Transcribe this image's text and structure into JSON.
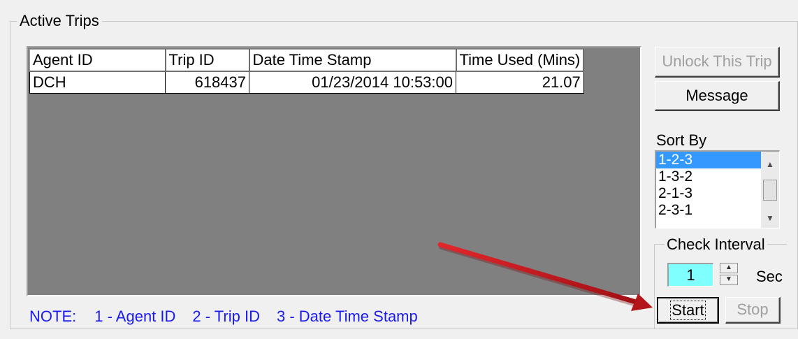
{
  "group_title": "Active Trips",
  "grid": {
    "columns": [
      "Agent ID",
      "Trip ID",
      "Date Time Stamp",
      "Time Used (Mins)"
    ],
    "rows": [
      [
        "DCH",
        "618437",
        "01/23/2014 10:53:00",
        "21.07"
      ]
    ]
  },
  "buttons": {
    "unlock": "Unlock This Trip",
    "message": "Message",
    "start": "Start",
    "stop": "Stop"
  },
  "sort": {
    "label": "Sort By",
    "options": [
      "1-2-3",
      "1-3-2",
      "2-1-3",
      "2-3-1"
    ],
    "selected": "1-2-3"
  },
  "interval": {
    "label": "Check Interval",
    "value": "1",
    "unit": "Sec"
  },
  "note": {
    "prefix": "NOTE:",
    "items": [
      "1 - Agent ID",
      "2 - Trip ID",
      "3 - Date Time Stamp"
    ]
  },
  "colors": {
    "note_text": "#1a1af0",
    "selection": "#3399ff",
    "interval_field": "#80ffff",
    "grid_background": "#808080",
    "annotation_arrow": "#c0161b"
  },
  "icons": {
    "scroll_up": "scroll-up-arrow-icon",
    "scroll_down": "scroll-down-arrow-icon",
    "spin_up": "spin-up-arrow-icon",
    "spin_down": "spin-down-arrow-icon",
    "annotation": "red-pointer-arrow-icon"
  }
}
